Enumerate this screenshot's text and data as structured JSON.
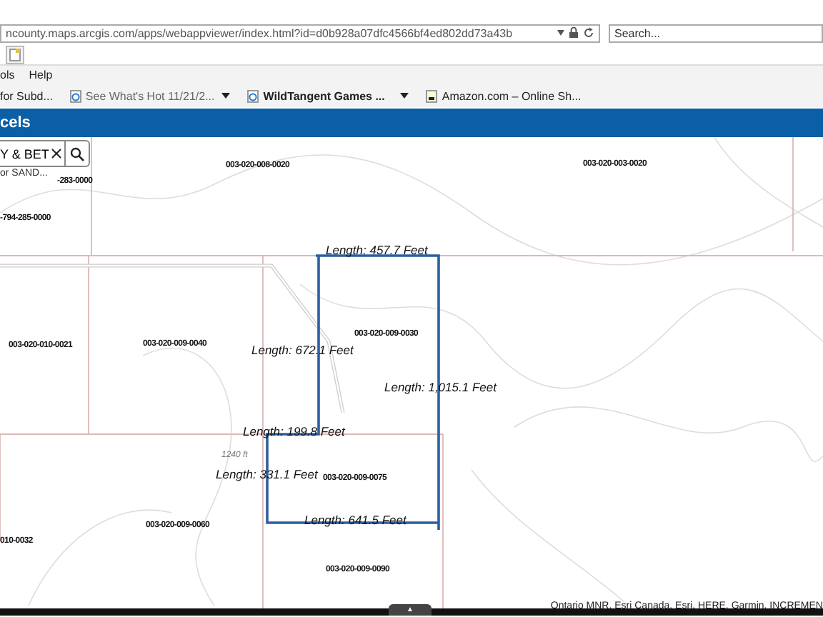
{
  "browser": {
    "url": "ncounty.maps.arcgis.com/apps/webappviewer/index.html?id=d0b928a07dfc4566bf4ed802dd73a43b",
    "search_placeholder": "Search...",
    "menu": [
      "ols",
      "Help"
    ],
    "favorites": [
      {
        "label": "for Subd...",
        "kind": "plain"
      },
      {
        "label": "See What's Hot 11/21/2...",
        "kind": "dropdown"
      },
      {
        "label": "WildTangent Games ...",
        "kind": "dropdown"
      },
      {
        "label": "Amazon.com – Online Sh...",
        "kind": "plain"
      }
    ]
  },
  "app": {
    "title": "cels"
  },
  "search": {
    "value": "Y & BET",
    "suggestion": "or SAND..."
  },
  "map": {
    "parcels": [
      "-283-0000",
      "003-020-008-0020",
      "003-020-003-0020",
      "-794-285-0000",
      "003-020-010-0021",
      "003-020-009-0040",
      "003-020-009-0030",
      "003-020-009-0075",
      "003-020-009-0060",
      "010-0032",
      "003-020-009-0090"
    ],
    "measurements": [
      "Length: 457.7 Feet",
      "Length: 672.1 Feet",
      "Length: 1,015.1 Feet",
      "Length: 199.8 Feet",
      "Length: 331.1 Feet",
      "Length: 641.5 Feet"
    ],
    "contour_label": "1240 ft",
    "attribution": "Ontario MNR, Esri Canada, Esri, HERE, Garmin, INCREMEN",
    "expand_handle": "▲"
  }
}
